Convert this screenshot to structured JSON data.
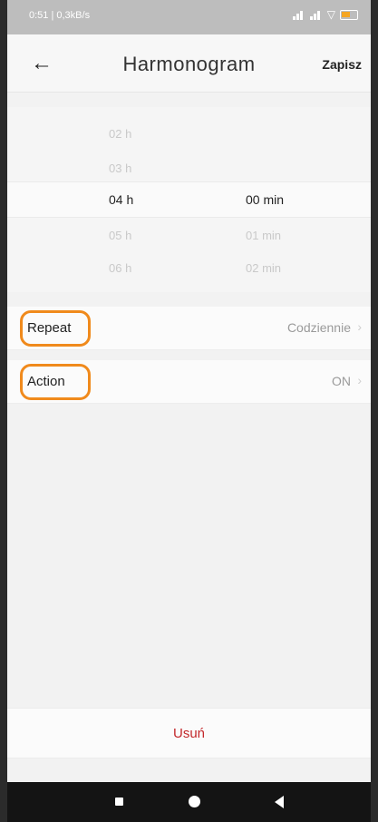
{
  "status": {
    "time": "0:51 | 0,3kB/s"
  },
  "header": {
    "title": "Harmonogram",
    "save_label": "Zapisz"
  },
  "picker": {
    "hours": [
      "02 h",
      "03 h",
      "04 h",
      "05 h",
      "06 h"
    ],
    "minutes": [
      "00 min",
      "01 min",
      "02 min"
    ],
    "selected_hour": "04 h",
    "selected_minute": "00 min"
  },
  "settings": [
    {
      "label": "Repeat",
      "value": "Codziennie"
    },
    {
      "label": "Action",
      "value": "ON"
    }
  ],
  "footer": {
    "delete_label": "Usuń"
  },
  "colors": {
    "highlight": "#f08a1c",
    "delete": "#c3282b"
  },
  "icons": {
    "back": "arrow-left-icon",
    "chevron": "chevron-right-icon"
  }
}
